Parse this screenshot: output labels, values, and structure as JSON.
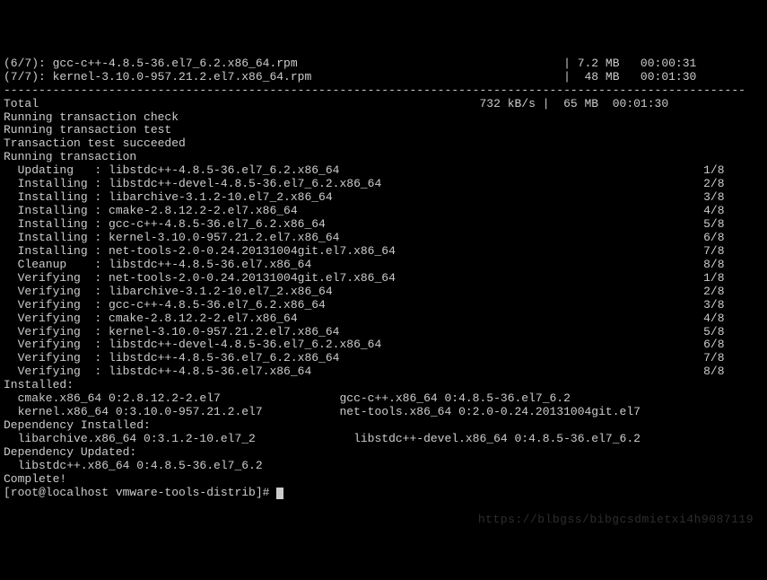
{
  "downloads": [
    "(6/7): gcc-c++-4.8.5-36.el7_6.2.x86_64.rpm                                      | 7.2 MB   00:00:31",
    "(7/7): kernel-3.10.0-957.21.2.el7.x86_64.rpm                                    |  48 MB   00:01:30"
  ],
  "divider": "----------------------------------------------------------------------------------------------------------",
  "total": "Total                                                               732 kB/s |  65 MB  00:01:30",
  "status_lines": [
    "Running transaction check",
    "Running transaction test",
    "Transaction test succeeded",
    "Running transaction"
  ],
  "transactions": [
    "  Updating   : libstdc++-4.8.5-36.el7_6.2.x86_64                                                    1/8",
    "  Installing : libstdc++-devel-4.8.5-36.el7_6.2.x86_64                                              2/8",
    "  Installing : libarchive-3.1.2-10.el7_2.x86_64                                                     3/8",
    "  Installing : cmake-2.8.12.2-2.el7.x86_64                                                          4/8",
    "  Installing : gcc-c++-4.8.5-36.el7_6.2.x86_64                                                      5/8",
    "  Installing : kernel-3.10.0-957.21.2.el7.x86_64                                                    6/8",
    "  Installing : net-tools-2.0-0.24.20131004git.el7.x86_64                                            7/8",
    "  Cleanup    : libstdc++-4.8.5-36.el7.x86_64                                                        8/8",
    "  Verifying  : net-tools-2.0-0.24.20131004git.el7.x86_64                                            1/8",
    "  Verifying  : libarchive-3.1.2-10.el7_2.x86_64                                                     2/8",
    "  Verifying  : gcc-c++-4.8.5-36.el7_6.2.x86_64                                                      3/8",
    "  Verifying  : cmake-2.8.12.2-2.el7.x86_64                                                          4/8",
    "  Verifying  : kernel-3.10.0-957.21.2.el7.x86_64                                                    5/8",
    "  Verifying  : libstdc++-devel-4.8.5-36.el7_6.2.x86_64                                              6/8",
    "  Verifying  : libstdc++-4.8.5-36.el7_6.2.x86_64                                                    7/8",
    "  Verifying  : libstdc++-4.8.5-36.el7.x86_64                                                        8/8"
  ],
  "installed_header": "Installed:",
  "installed_lines": [
    "  cmake.x86_64 0:2.8.12.2-2.el7                 gcc-c++.x86_64 0:4.8.5-36.el7_6.2",
    "  kernel.x86_64 0:3.10.0-957.21.2.el7           net-tools.x86_64 0:2.0-0.24.20131004git.el7"
  ],
  "dep_installed_header": "Dependency Installed:",
  "dep_installed_lines": [
    "  libarchive.x86_64 0:3.1.2-10.el7_2              libstdc++-devel.x86_64 0:4.8.5-36.el7_6.2"
  ],
  "dep_updated_header": "Dependency Updated:",
  "dep_updated_lines": [
    "  libstdc++.x86_64 0:4.8.5-36.el7_6.2"
  ],
  "complete": "Complete!",
  "prompt": "[root@localhost vmware-tools-distrib]# ",
  "watermark": "https://blbgss/bibgcsdmietxi4h9087119"
}
